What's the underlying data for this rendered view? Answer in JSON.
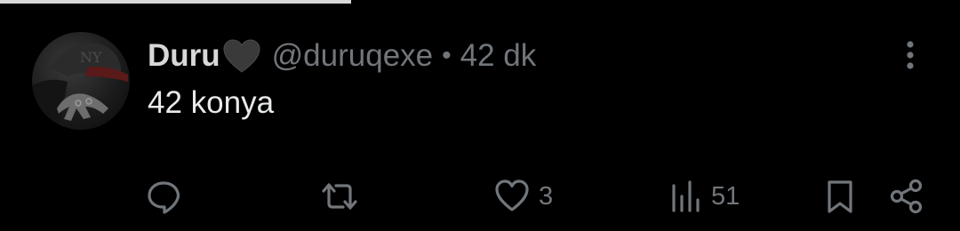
{
  "tweet": {
    "author": {
      "display_name": "Duru",
      "name_emoji": "black-heart",
      "handle": "@duruqexe"
    },
    "separator": "•",
    "time": "42 dk",
    "text": "42 konya",
    "actions": {
      "reply_count": "",
      "retweet_count": "",
      "like_count": "3",
      "view_count": "51"
    },
    "icons": [
      "reply-icon",
      "retweet-icon",
      "heart-icon",
      "views-icon",
      "bookmark-icon",
      "share-icon",
      "more-icon"
    ],
    "colors": {
      "background": "#000000",
      "text": "#e7e9ea",
      "secondary": "#71767b"
    }
  }
}
